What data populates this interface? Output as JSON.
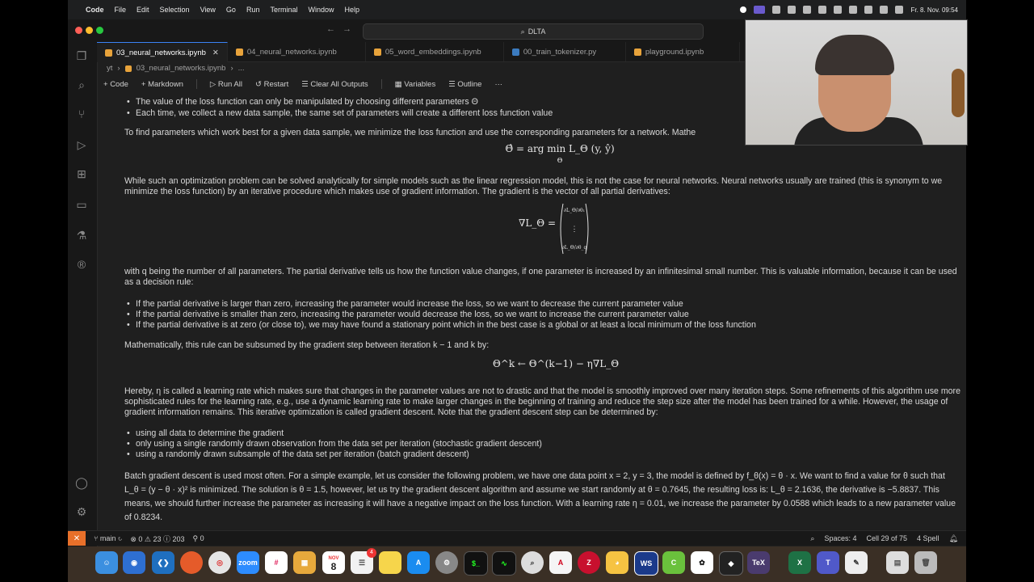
{
  "menubar": {
    "app": "Code",
    "items": [
      "File",
      "Edit",
      "Selection",
      "View",
      "Go",
      "Run",
      "Terminal",
      "Window",
      "Help"
    ],
    "datetime": "Fr. 8. Nov.  09:54"
  },
  "titlebar": {
    "search": "DLTA"
  },
  "tabs": [
    {
      "label": "03_neural_networks.ipynb",
      "active": true
    },
    {
      "label": "04_neural_networks.ipynb"
    },
    {
      "label": "05_word_embeddings.ipynb"
    },
    {
      "label": "00_train_tokenizer.py"
    },
    {
      "label": "playground.ipynb"
    }
  ],
  "breadcrumb": {
    "root": "yt",
    "file": "03_neural_networks.ipynb",
    "more": "..."
  },
  "toolbar": {
    "code": "Code",
    "markdown": "Markdown",
    "run_all": "Run All",
    "restart": "Restart",
    "clear": "Clear All Outputs",
    "variables": "Variables",
    "outline": "Outline",
    "more": "···"
  },
  "content": {
    "bullet_a1": "The value of the loss function can only be manipulated by choosing different parameters Θ",
    "bullet_a2": "Each time, we collect a new data sample, the same set of parameters will create a different loss function value",
    "p1": "To find parameters which work best for a given data sample, we minimize the loss function and use the corresponding parameters for a network. Mathe",
    "eq1": "Θ̂ = arg min L_Θ (y, ŷ)",
    "eq1_sub": "Θ",
    "p2": "While such an optimization problem can be solved analytically for simple models such as the linear regression model, this is not the case for neural networks. Neural networks usually are trained (this is synonym to we minimize the loss function) by an iterative procedure which makes use of gradient information. The gradient is the vector of all partial derivatives:",
    "eq2": "∇L_Θ =",
    "p3": "with q being the number of all parameters. The partial derivative tells us how the function value changes, if one parameter is increased by an infinitesimal small number. This is valuable information, because it can be used as a decision rule:",
    "bullet_b1": "If the partial derivative is larger than zero, increasing the parameter would increase the loss, so we want to decrease the current parameter value",
    "bullet_b2": "If the partial derivative is smaller than zero, increasing the parameter would decrease the loss, so we want to increase the current parameter value",
    "bullet_b3": "If the partial derivative is at zero (or close to), we may have found a stationary point which in the best case is a global or at least a local minimum of the loss function",
    "p4": "Mathematically, this rule can be subsumed by the gradient step between iteration k − 1 and k by:",
    "eq3": "Θ^k ← Θ^(k−1) − η∇L_Θ",
    "p5": "Hereby, η is called a learning rate which makes sure that changes in the parameter values are not to drastic and that the model is smoothly improved over many iteration steps. Some refinements of this algorithm use more sophisticated rules for the learning rate, e.g., use a dynamic learning rate to make larger changes in the beginning of training and reduce the step size after the model has been trained for a while. However, the usage of gradient information remains. This iterative optimization is called gradient descent. Note that the gradient descent step can be determined by:",
    "bullet_c1": "using all data to determine the gradient",
    "bullet_c2": "only using a single randomly drawn observation from the data set per iteration (stochastic gradient descent)",
    "bullet_c3": "using a randomly drawn subsample of the data set per iteration (batch gradient descent)",
    "p6": "Batch gradient descent is used most often. For a simple example, let us consider the following problem, we have one data point x = 2, y = 3, the model is defined by f_θ(x) = θ · x. We want to find a value for θ such that L_θ = (y − θ · x)² is minimized. The solution is θ = 1.5, however, let us try the gradient descent algorithm and assume we start randomly at θ = 0.7645, the resulting loss is: L_θ = 2.1636, the derivative is −5.8837. This means, we should further increase the parameter as increasing it will have a negative impact on the loss function. With a learning rate η = 0.01, we increase the parameter by 0.0588 which leads to a new parameter value of 0.8234."
  },
  "statusbar": {
    "branch": "main",
    "problems": "⊗ 0 ⚠ 23 ⓘ 203",
    "ports": "⚲ 0",
    "spaces": "Spaces: 4",
    "cell": "Cell 29 of 75",
    "spell": "4 Spell"
  },
  "dock": {
    "calendar_day": "8",
    "calendar_month": "NOV",
    "mail_badge": "4"
  }
}
